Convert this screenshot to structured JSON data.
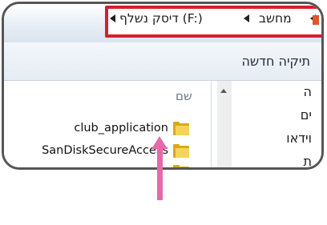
{
  "address_bar": {
    "crumbs": [
      {
        "label": "מחשב"
      },
      {
        "label": "דיסק נשלף (F:)"
      }
    ]
  },
  "toolbar": {
    "new_folder_label": "תיקיה חדשה"
  },
  "file_list": {
    "column_name": "שם",
    "rows": [
      {
        "name": "club_application",
        "icon": "folder-icon"
      },
      {
        "name": "SanDiskSecureAccess",
        "icon": "folder-icon"
      },
      {
        "name": "",
        "icon": "folder-icon"
      }
    ]
  },
  "nav_pane": {
    "items": [
      {
        "label": "ה"
      },
      {
        "label": "ים"
      },
      {
        "label": "וידאו"
      },
      {
        "label": "ת"
      }
    ]
  },
  "annotation": {
    "highlight_color": "#d61f2b",
    "arrow_color": "#e46aa8"
  }
}
